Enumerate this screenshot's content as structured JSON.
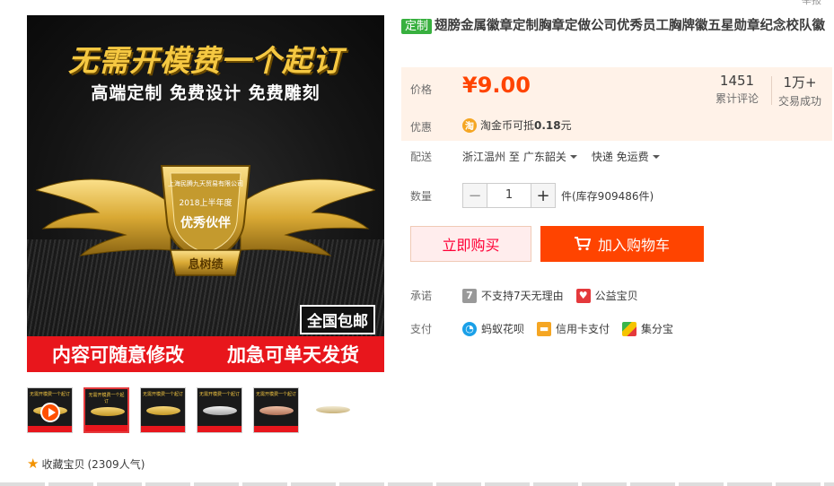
{
  "corner_text": "举报",
  "main_image": {
    "headline": "无需开模费一个起订",
    "subline": "高端定制  免费设计  免费雕刻",
    "badge_company": "上海民腾九天贸易有限公司",
    "badge_year": "2018上半年度",
    "badge_award": "优秀伙伴",
    "badge_name": "息树绩",
    "free_ship": "全国包邮",
    "bar_left": "内容可随意修改",
    "bar_right": "加急可单天发货"
  },
  "thumbs": [
    {
      "name": "video",
      "caption": "无需开模费一个起订"
    },
    {
      "name": "gold",
      "caption": "无需开模费一个起订"
    },
    {
      "name": "gold2",
      "caption": "无需开模费一个起订"
    },
    {
      "name": "silver",
      "caption": "无需开模费一个起订"
    },
    {
      "name": "rose",
      "caption": "无需开模费一个起订"
    },
    {
      "name": "plain",
      "caption": ""
    }
  ],
  "favorite": {
    "label": "收藏宝贝",
    "count": "(2309人气)"
  },
  "product": {
    "tag": "定制",
    "title": "翅膀金属徽章定制胸章定做公司优秀员工胸牌徽五星勋章纪念校队徽"
  },
  "price": {
    "label": "价格",
    "value": "¥9.00",
    "reviews_num": "1451",
    "reviews_label": "累计评论",
    "deals_num": "1万+",
    "deals_label": "交易成功"
  },
  "promo": {
    "label": "优惠",
    "icon": "淘",
    "text": "淘金币可抵",
    "amount": "0.18",
    "unit": "元"
  },
  "shipping": {
    "label": "配送",
    "from": "浙江温州 至",
    "to": "广东韶关",
    "method": "快递 免运费"
  },
  "quantity": {
    "label": "数量",
    "minus": "−",
    "value": "1",
    "plus": "+",
    "stock": "件(库存909486件)"
  },
  "buttons": {
    "buy": "立即购买",
    "cart": "加入购物车"
  },
  "promise": {
    "label": "承诺",
    "items": [
      "不支持7天无理由",
      "公益宝贝"
    ]
  },
  "payment": {
    "label": "支付",
    "items": [
      "蚂蚁花呗",
      "信用卡支付",
      "集分宝"
    ]
  }
}
